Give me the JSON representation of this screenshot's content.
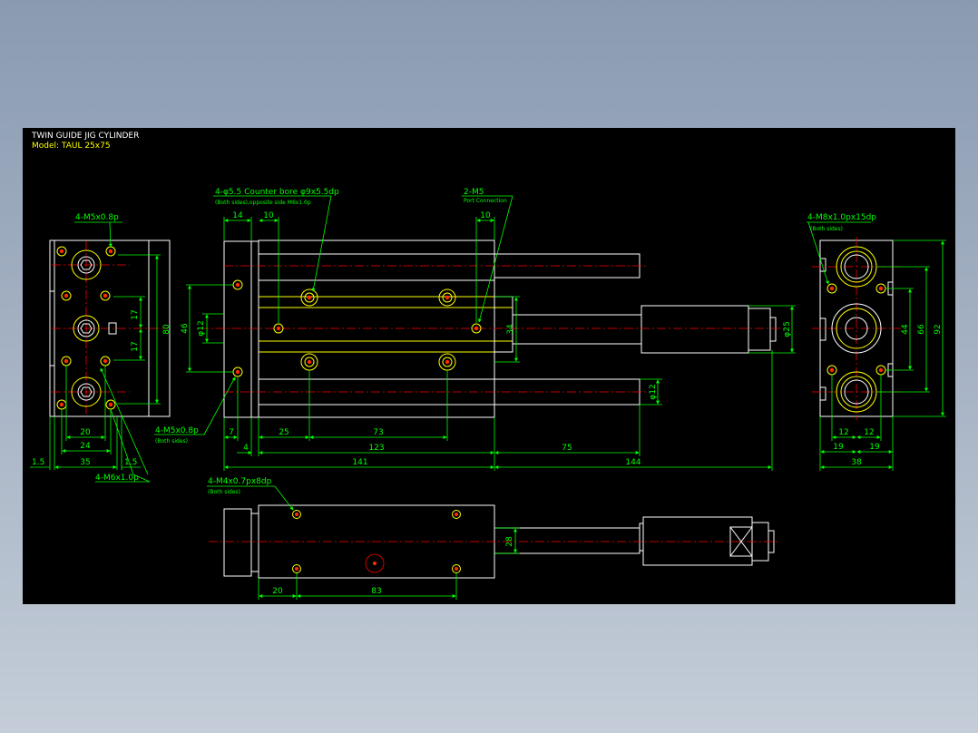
{
  "title_block": {
    "line1": "TWIN GUIDE JIG CYLINDER",
    "line2": "Model: TAUL 25x75"
  },
  "left_view": {
    "callout_top": "4-M5x0.8p",
    "dim_17a": "17",
    "dim_17b": "17",
    "dim_80": "80",
    "dim_20": "20",
    "dim_24": "24",
    "dim_35": "35",
    "dim_1_5_left": "1.5",
    "dim_1_5_right": "1.5",
    "callout_bottom": "4-M6x1.0p"
  },
  "front_view": {
    "callout_counterbore": "4-φ5.5 Counter bore φ9x5.5dp",
    "callout_counterbore_sub": "(Both sides),opposite side M6x1.0p",
    "callout_port": "2-M5",
    "callout_port_sub": "Port Connection",
    "dim_14": "14",
    "dim_10a": "10",
    "dim_10b": "10",
    "dim_46": "46",
    "dim_phi12a": "φ12",
    "dim_34": "34",
    "dim_phi25": "φ25",
    "dim_phi12b": "φ12",
    "callout_m5": "4-M5x0.8p",
    "callout_m5_sub": "(Both sides)",
    "dim_7": "7",
    "dim_25": "25",
    "dim_73": "73",
    "dim_4": "4",
    "dim_123": "123",
    "dim_75": "75",
    "dim_141": "141",
    "dim_144": "144"
  },
  "right_view": {
    "callout": "4-M8x1.0px15dp",
    "callout_sub": "(Both sides)",
    "dim_44": "44",
    "dim_66": "66",
    "dim_92": "92",
    "dim_12a": "12",
    "dim_12b": "12",
    "dim_19a": "19",
    "dim_19b": "19",
    "dim_38": "38"
  },
  "bottom_view": {
    "callout": "4-M4x0.7px8dp",
    "callout_sub": "(Both sides)",
    "dim_28": "28",
    "dim_20": "20",
    "dim_83": "83"
  },
  "colors": {
    "background": "#000000",
    "outline": "#ffffff",
    "hole": "#ffff00",
    "dimension": "#00ff00",
    "centerline": "#ff0000"
  }
}
